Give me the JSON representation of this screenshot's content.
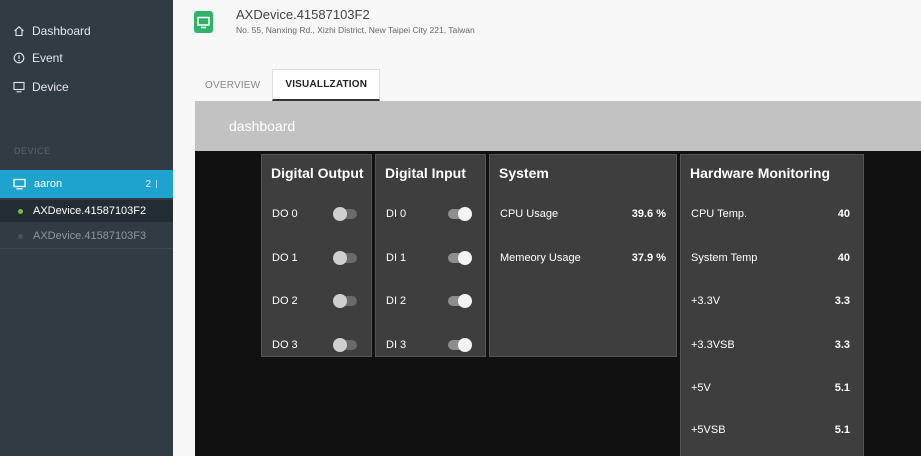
{
  "sidebar": {
    "nav": [
      {
        "label": "Dashboard",
        "icon": "home-icon"
      },
      {
        "label": "Event",
        "icon": "info-circle-icon"
      },
      {
        "label": "Device",
        "icon": "monitor-icon"
      }
    ],
    "section_label": "DEVICE",
    "group": {
      "label": "aaron",
      "count": "2",
      "icon": "monitor-icon"
    },
    "devices": [
      {
        "name": "AXDevice.41587103F2",
        "status": "online"
      },
      {
        "name": "AXDevice.41587103F3",
        "status": "offline"
      }
    ]
  },
  "header": {
    "title": "AXDevice.41587103F2",
    "address": "No. 55, Nanxing Rd., Xizhi District, New Taipei City 221, Taiwan",
    "badge_color": "#2fb36b"
  },
  "tabs": [
    {
      "label": "OVERVIEW",
      "active": false
    },
    {
      "label": "VISUALLZATION",
      "active": true
    }
  ],
  "dashboard": {
    "title": "dashboard",
    "digital_output": {
      "title": "Digital Output",
      "items": [
        {
          "label": "DO 0",
          "on": false
        },
        {
          "label": "DO 1",
          "on": false
        },
        {
          "label": "DO 2",
          "on": false
        },
        {
          "label": "DO 3",
          "on": false
        }
      ]
    },
    "digital_input": {
      "title": "Digital Input",
      "items": [
        {
          "label": "DI 0",
          "on": true
        },
        {
          "label": "DI 1",
          "on": true
        },
        {
          "label": "DI 2",
          "on": true
        },
        {
          "label": "DI 3",
          "on": true
        }
      ]
    },
    "system": {
      "title": "System",
      "items": [
        {
          "label": "CPU Usage",
          "value": "39.6 %"
        },
        {
          "label": "Memeory Usage",
          "value": "37.9 %"
        }
      ]
    },
    "hardware": {
      "title": "Hardware Monitoring",
      "items": [
        {
          "label": "CPU Temp.",
          "value": "40"
        },
        {
          "label": "System Temp",
          "value": "40"
        },
        {
          "label": "+3.3V",
          "value": "3.3"
        },
        {
          "label": "+3.3VSB",
          "value": "3.3"
        },
        {
          "label": "+5V",
          "value": "5.1"
        },
        {
          "label": "+5VSB",
          "value": "5.1"
        }
      ]
    }
  },
  "colors": {
    "accent": "#1ea3cf",
    "sidebar": "#313b44",
    "online": "#6bc04b"
  }
}
